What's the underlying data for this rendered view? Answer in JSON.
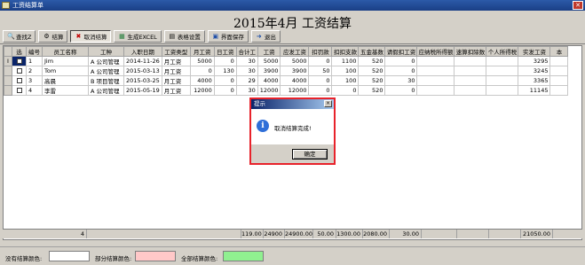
{
  "window": {
    "title": "工资结算单",
    "close_glyph": "✕"
  },
  "page_title": "2015年4月 工资结算",
  "toolbar": [
    {
      "label": "查找Z",
      "icon": "binoculars-icon",
      "glyph": "🔍"
    },
    {
      "label": "结算",
      "icon": "gear-icon",
      "glyph": "⚙"
    },
    {
      "label": "取消结算",
      "icon": "red-x-icon",
      "glyph": "✖"
    },
    {
      "label": "生成EXCEL",
      "icon": "excel-icon",
      "glyph": "▦"
    },
    {
      "label": "表格设置",
      "icon": "table-settings-icon",
      "glyph": "▤"
    },
    {
      "label": "界面保存",
      "icon": "save-icon",
      "glyph": "▣"
    },
    {
      "label": "退出",
      "icon": "exit-icon",
      "glyph": "➜"
    }
  ],
  "columns": [
    "选",
    "编号",
    "员工名称",
    "工种",
    "入职日期",
    "工资类型",
    "月工资",
    "日工资",
    "合计工",
    "工资",
    "应发工资",
    "扣罚款",
    "扣扣支款",
    "五金基数",
    "请假扣工资",
    "应纳税所得额",
    "速算扣除数",
    "个人所得税",
    "实发工资",
    "本"
  ],
  "rows": [
    {
      "indicator": "I",
      "checked": true,
      "cells": [
        "1",
        "Jim",
        "A 公司管理",
        "2014-11-26",
        "月工资",
        "5000",
        "0",
        "30",
        "5000",
        "5000",
        "0",
        "1100",
        "520",
        "0",
        "",
        "",
        "",
        "3295",
        ""
      ]
    },
    {
      "indicator": "",
      "checked": false,
      "cells": [
        "2",
        "Tom",
        "A 公司管理",
        "2015-03-13",
        "月工资",
        "0",
        "130",
        "30",
        "3900",
        "3900",
        "50",
        "100",
        "520",
        "0",
        "",
        "",
        "",
        "3245",
        ""
      ]
    },
    {
      "indicator": "",
      "checked": false,
      "cells": [
        "3",
        "高晨",
        "B 项目管理",
        "2015-03-25",
        "月工资",
        "4000",
        "0",
        "29",
        "4000",
        "4000",
        "0",
        "100",
        "520",
        "30",
        "",
        "",
        "",
        "3365",
        ""
      ]
    },
    {
      "indicator": "",
      "checked": false,
      "cells": [
        "4",
        "李雷",
        "A 公司管理",
        "2015-05-19",
        "月工资",
        "12000",
        "0",
        "30",
        "12000",
        "12000",
        "0",
        "0",
        "520",
        "0",
        "",
        "",
        "",
        "11145",
        ""
      ]
    }
  ],
  "footer": {
    "count": "4",
    "totals": [
      "119.00",
      "24900",
      "24900.00",
      "50.00",
      "1300.00",
      "2080.00",
      "30.00",
      "",
      "",
      "",
      "21050.00"
    ]
  },
  "legend": {
    "items": [
      {
        "label": "没有结算颜色:",
        "color": "#ffffff"
      },
      {
        "label": "部分结算颜色:",
        "color": "#ffc8c8"
      },
      {
        "label": "全部结算颜色:",
        "color": "#90f090"
      }
    ]
  },
  "dialog": {
    "title": "提示",
    "message": "取消结算完成!",
    "ok_label": "确定",
    "close_glyph": "×"
  }
}
